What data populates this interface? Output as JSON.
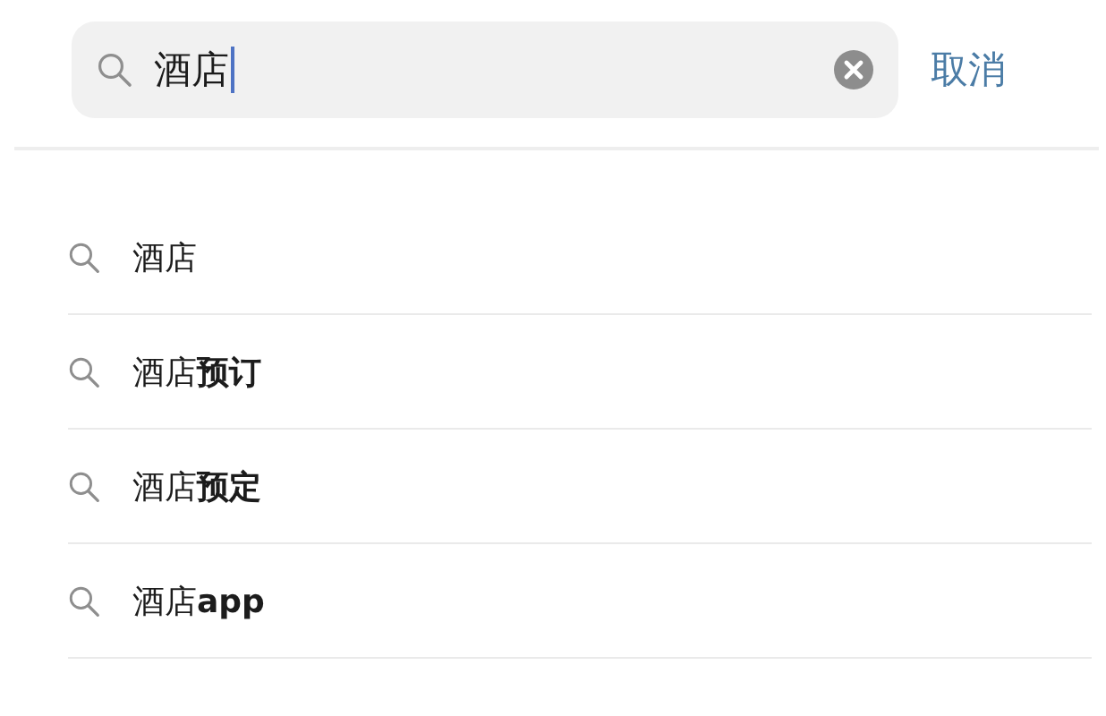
{
  "search": {
    "value": "酒店",
    "cancel": "取消"
  },
  "suggestions": [
    {
      "text": "酒店"
    },
    {
      "text": "酒店**预订**"
    },
    {
      "text": "酒店**预定**"
    },
    {
      "text": "酒店**app**"
    }
  ]
}
